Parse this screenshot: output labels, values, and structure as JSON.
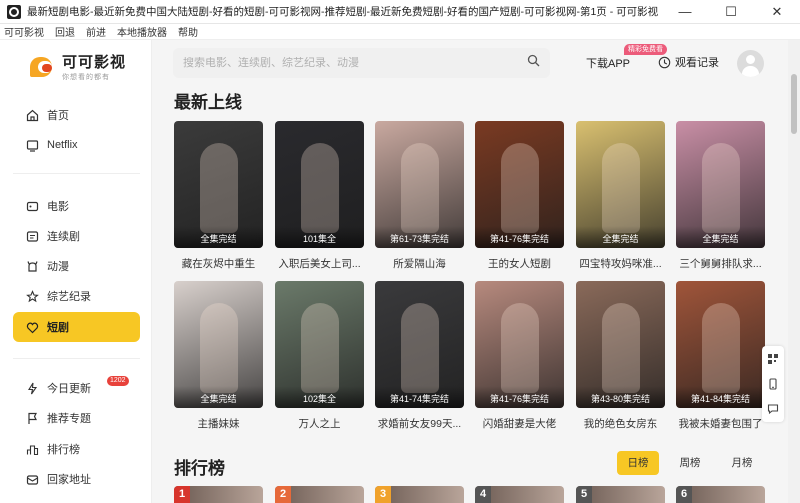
{
  "window": {
    "title": "最新短剧电影-最近新免费中国大陆短剧-好看的短剧-可可影视网-推荐短剧-最近新免费短剧-好看的国产短剧-可可影视网-第1页 - 可可影视",
    "controls": [
      "—",
      "☐",
      "✕"
    ]
  },
  "menu": [
    "可可影视",
    "回退",
    "前进",
    "本地播放器",
    "帮助"
  ],
  "logo": {
    "name": "可可影视",
    "slogan": "你想看的都有"
  },
  "sidebar": {
    "items": [
      {
        "label": "首页",
        "icon": "home-icon"
      },
      {
        "label": "Netflix",
        "icon": "netflix-icon"
      },
      {
        "label": "电影",
        "icon": "movie-icon"
      },
      {
        "label": "连续剧",
        "icon": "tv-icon"
      },
      {
        "label": "动漫",
        "icon": "anime-icon"
      },
      {
        "label": "综艺纪录",
        "icon": "variety-icon"
      },
      {
        "label": "短剧",
        "icon": "shortdrama-icon",
        "active": true
      },
      {
        "label": "今日更新",
        "icon": "update-icon",
        "badge": "1202"
      },
      {
        "label": "推荐专题",
        "icon": "topic-icon"
      },
      {
        "label": "排行榜",
        "icon": "ranking-icon"
      },
      {
        "label": "回家地址",
        "icon": "address-icon"
      }
    ]
  },
  "header": {
    "search_placeholder": "搜索电影、连续剧、综艺纪录、动漫",
    "download_label": "下载APP",
    "download_badge": "精彩免费看",
    "history_label": "观看记录"
  },
  "latest": {
    "title": "最新上线",
    "items": [
      {
        "title": "藏在灰烬中重生",
        "badge": "全集完结",
        "color": "#3b3b3b"
      },
      {
        "title": "入职后美女上司...",
        "badge": "101集全",
        "color": "#2a2a2e"
      },
      {
        "title": "所爱隔山海",
        "badge": "第61-73集完结",
        "color": "#c9a9a0"
      },
      {
        "title": "王的女人短剧",
        "badge": "第41-76集完结",
        "color": "#7a3a22"
      },
      {
        "title": "四宝特攻妈咪准...",
        "badge": "全集完结",
        "color": "#d9c070"
      },
      {
        "title": "三个舅舅排队求...",
        "badge": "全集完结",
        "color": "#c98fa6"
      },
      {
        "title": "主播妹妹",
        "badge": "全集完结",
        "color": "#d8d0cc"
      },
      {
        "title": "万人之上",
        "badge": "102集全",
        "color": "#6b7a6a"
      },
      {
        "title": "求婚前女友99天...",
        "badge": "第41-74集完结",
        "color": "#3a3a3c"
      },
      {
        "title": "闪婚甜妻是大佬",
        "badge": "第41-76集完结",
        "color": "#b78a7e"
      },
      {
        "title": "我的绝色女房东",
        "badge": "第43-80集完结",
        "color": "#8a6a5a"
      },
      {
        "title": "我被未婚妻包围了",
        "badge": "第41-84集完结",
        "color": "#a0553a"
      }
    ]
  },
  "ranking": {
    "title": "排行榜",
    "tabs": [
      {
        "label": "日榜",
        "active": true
      },
      {
        "label": "周榜"
      },
      {
        "label": "月榜"
      }
    ],
    "items": [
      {
        "rank": "1",
        "color": "#d7352c"
      },
      {
        "rank": "2",
        "color": "#e6693a"
      },
      {
        "rank": "3",
        "color": "#f0a22b"
      },
      {
        "rank": "4",
        "color": "#555"
      },
      {
        "rank": "5",
        "color": "#555"
      },
      {
        "rank": "6",
        "color": "#555"
      }
    ]
  }
}
